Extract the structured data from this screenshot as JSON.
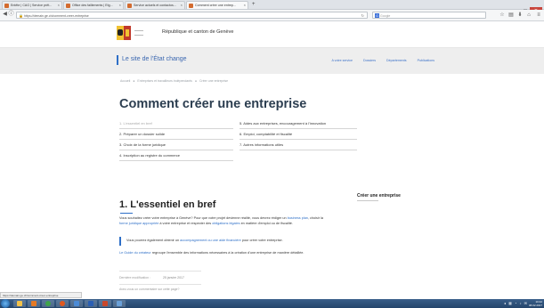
{
  "browser": {
    "tabs": [
      {
        "label": "Entête | CAG | Service prêt...",
        "color": "#d36b2f"
      },
      {
        "label": "Office des faillements | Etg...",
        "color": "#d36b2f"
      },
      {
        "label": "Service actuels et contactos...",
        "color": "#d36b2f"
      },
      {
        "label": "Comment créer une entrep...",
        "color": "#d36b2f"
      }
    ],
    "new_tab": "+",
    "url": "https://demain.ge.ch/comment-creer-entreprise",
    "search_placeholder": "Google",
    "window_buttons": {
      "minimize": "–",
      "maximize": "□",
      "close": "✕"
    }
  },
  "header": {
    "site_title": "République et canton de Genève"
  },
  "subnav": {
    "brand": "Le site de l'État change",
    "links": [
      "A votre service",
      "Dossiers",
      "Départements",
      "Publications"
    ]
  },
  "breadcrumb": [
    "Accueil",
    "Entreprises et travailleurs indépendants",
    "Créer une entreprise"
  ],
  "page_title": "Comment créer une entreprise",
  "toc": [
    "1. L'essentiel en bref",
    "2. Préparer un dossier solide",
    "3. Choix de la forme juridique",
    "4. Inscription au registre du commerce",
    "5. Aides aux entreprises, encouragement à l'innovation",
    "6. Emploi, comptabilité et fiscalité",
    "7. Autres informations utiles"
  ],
  "section": {
    "title": "1. L'essentiel en bref",
    "p1_a": "Vous souhaitez créer votre entreprise à Genève? Pour que votre projet devienne réalité, vous devrez rédiger un ",
    "p1_link1": "business plan",
    "p1_b": ", choisir la ",
    "p1_link2": "forme juridique appropriée",
    "p1_c": " à votre entreprise et respecter des ",
    "p1_link3": "obligations légales",
    "p1_d": " en matière d'emploi ou de fiscalité.",
    "quote_a": "Vous pourrez également obtenir un ",
    "quote_link": "accompagnement ou une aide financière",
    "quote_b": " pour créer votre entreprise.",
    "p2_link": "Le Guide du créateur",
    "p2_text": " regroupe l'ensemble des informations nécessaires à la création d'une entreprise de manière détaillée.",
    "meta_label": "Dernière modification :",
    "meta_date": "25 janvier 2017",
    "feedback": "Avez-vous un commentaire sur cette page?"
  },
  "sidebar": {
    "title": "Créer une entreprise"
  },
  "statusbar": "https://demain.ge.ch/comment-creer-entreprise",
  "taskbar": {
    "clock_time": "10:42",
    "clock_date": "08.02.2017",
    "tray_icons": "◂ ▦ ◔ ♪ ✉"
  }
}
